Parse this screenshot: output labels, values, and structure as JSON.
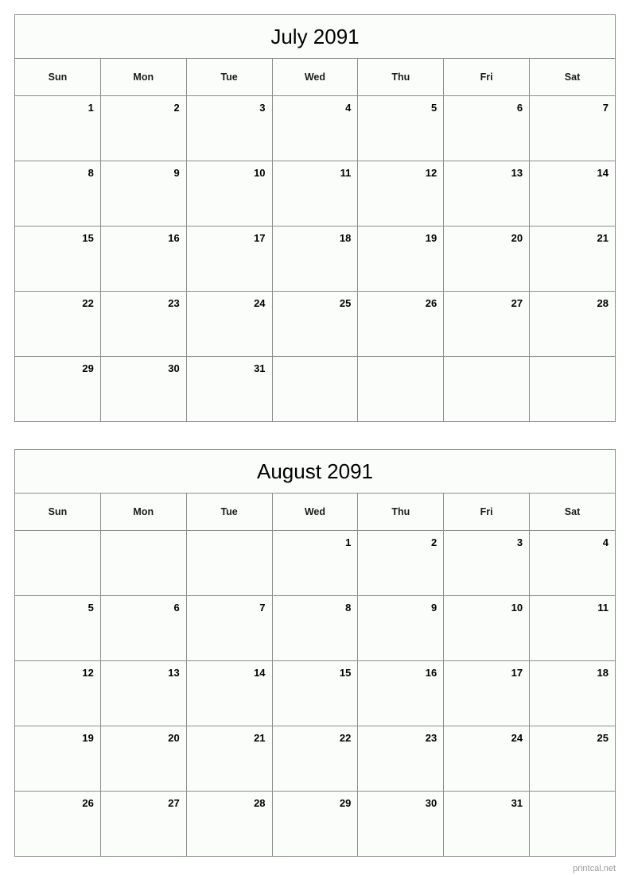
{
  "footer": {
    "credit": "printcal.net"
  },
  "weekday_headers": [
    "Sun",
    "Mon",
    "Tue",
    "Wed",
    "Thu",
    "Fri",
    "Sat"
  ],
  "months": [
    {
      "title": "July 2091",
      "weeks": [
        [
          "1",
          "2",
          "3",
          "4",
          "5",
          "6",
          "7"
        ],
        [
          "8",
          "9",
          "10",
          "11",
          "12",
          "13",
          "14"
        ],
        [
          "15",
          "16",
          "17",
          "18",
          "19",
          "20",
          "21"
        ],
        [
          "22",
          "23",
          "24",
          "25",
          "26",
          "27",
          "28"
        ],
        [
          "29",
          "30",
          "31",
          "",
          "",
          "",
          ""
        ]
      ]
    },
    {
      "title": "August 2091",
      "weeks": [
        [
          "",
          "",
          "",
          "1",
          "2",
          "3",
          "4"
        ],
        [
          "5",
          "6",
          "7",
          "8",
          "9",
          "10",
          "11"
        ],
        [
          "12",
          "13",
          "14",
          "15",
          "16",
          "17",
          "18"
        ],
        [
          "19",
          "20",
          "21",
          "22",
          "23",
          "24",
          "25"
        ],
        [
          "26",
          "27",
          "28",
          "29",
          "30",
          "31",
          ""
        ]
      ]
    }
  ]
}
